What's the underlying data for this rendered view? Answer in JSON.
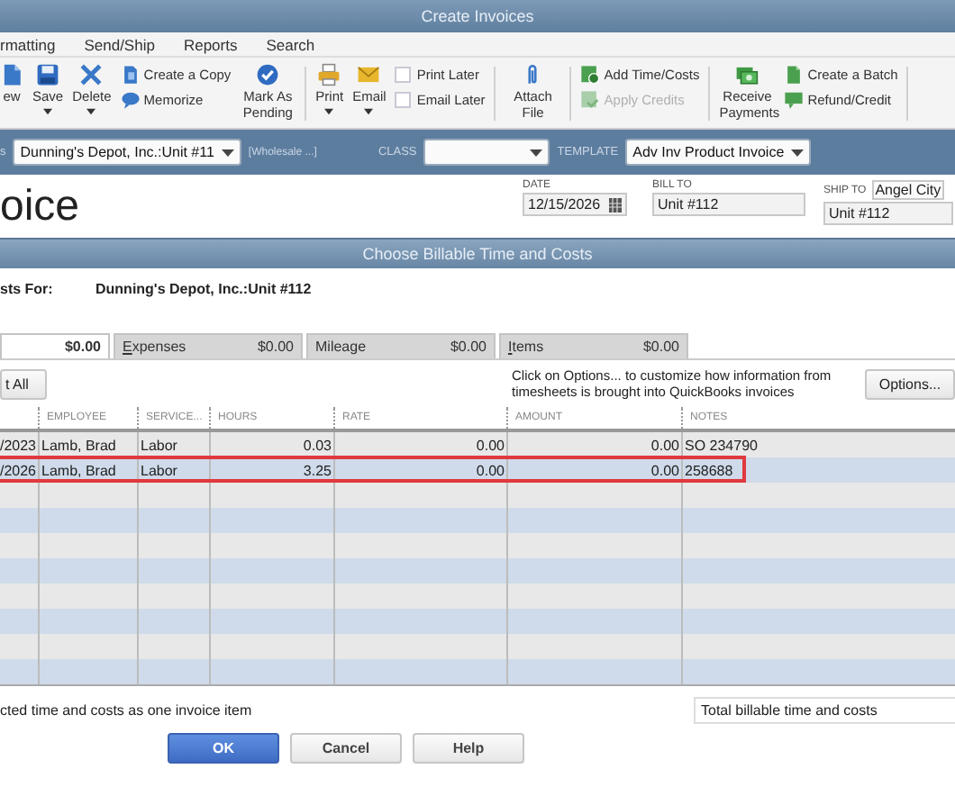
{
  "window": {
    "title": "Create Invoices"
  },
  "menu": [
    {
      "label": "rmatting"
    },
    {
      "label": "Send/Ship"
    },
    {
      "label": "Reports"
    },
    {
      "label": "Search"
    }
  ],
  "toolbar": [
    {
      "kind": "button",
      "label": "ew",
      "caret": false
    },
    {
      "kind": "button",
      "label": "Save",
      "caret": true
    },
    {
      "kind": "button",
      "label": "Delete",
      "caret": true
    },
    {
      "kind": "stack",
      "items": [
        {
          "label": "Create a Copy",
          "disabled": false
        },
        {
          "label": "Memorize",
          "disabled": false
        }
      ]
    },
    {
      "kind": "button",
      "label": "Mark As Pending",
      "caret": false
    },
    {
      "kind": "separator"
    },
    {
      "kind": "button",
      "label": "Print",
      "caret": true
    },
    {
      "kind": "button",
      "label": "Email",
      "caret": true
    },
    {
      "kind": "checks",
      "items": [
        {
          "label": "Print Later",
          "checked": false
        },
        {
          "label": "Email Later",
          "checked": false
        }
      ]
    },
    {
      "kind": "separator"
    },
    {
      "kind": "button",
      "label": "Attach File",
      "caret": false
    },
    {
      "kind": "separator"
    },
    {
      "kind": "stack",
      "items": [
        {
          "label": "Add Time/Costs",
          "disabled": false
        },
        {
          "label": "Apply Credits",
          "disabled": true
        }
      ]
    },
    {
      "kind": "separator"
    },
    {
      "kind": "button",
      "label": "Receive Payments",
      "caret": false
    },
    {
      "kind": "stack",
      "items": [
        {
          "label": "Create a Batch",
          "disabled": false
        },
        {
          "label": "Refund/Credit",
          "disabled": false
        }
      ]
    },
    {
      "kind": "separator"
    }
  ],
  "customer_bar": {
    "customer_label": "s",
    "customer": "Dunning's Depot, Inc.:Unit #11",
    "price_level": "[Wholesale ...]",
    "class_label": "CLASS",
    "template_label": "TEMPLATE",
    "template": "Adv Inv Product Invoice"
  },
  "form": {
    "title": "oice",
    "date_label": "DATE",
    "date": "12/15/2026",
    "bill_to_label": "BILL TO",
    "bill_to": "Unit #112",
    "ship_to_label": "SHIP TO",
    "ship_to_select": "Angel City",
    "ship_to": "Unit #112"
  },
  "dialog": {
    "title": "Choose Billable Time and Costs",
    "for_label": "sts For:",
    "for_value": "Dunning's Depot, Inc.:Unit #112",
    "tabs": [
      {
        "amount": "$0.00",
        "selected": true
      },
      {
        "label": "Expenses",
        "amount": "$0.00",
        "selected": false,
        "underline_first": true
      },
      {
        "label": "Mileage",
        "amount": "$0.00",
        "selected": false,
        "underline_first": false
      },
      {
        "label": "Items",
        "amount": "$0.00",
        "selected": false,
        "underline_first": true
      }
    ],
    "select_all_button": "t All",
    "hint": "Click on Options... to customize how information from timesheets is brought into QuickBooks invoices",
    "options_button": "Options...",
    "table": {
      "columns": [
        "",
        "EMPLOYEE",
        "SERVICE...",
        "HOURS",
        "RATE",
        "AMOUNT",
        "NOTES"
      ],
      "rows": [
        {
          "cells": [
            "/2023",
            "Lamb, Brad",
            "Labor",
            "0.03",
            "0.00",
            "0.00",
            "SO 234790"
          ],
          "highlighted": false
        },
        {
          "cells": [
            "/2026",
            "Lamb, Brad",
            "Labor",
            "3.25",
            "0.00",
            "0.00",
            "258688"
          ],
          "highlighted": true
        }
      ]
    },
    "footer_text": "cted time and costs as one invoice item",
    "total_field": "Total billable time and costs",
    "buttons": [
      {
        "label": "OK",
        "kind": "primary"
      },
      {
        "label": "Cancel",
        "kind": "normal"
      },
      {
        "label": "Help",
        "kind": "normal"
      }
    ]
  }
}
